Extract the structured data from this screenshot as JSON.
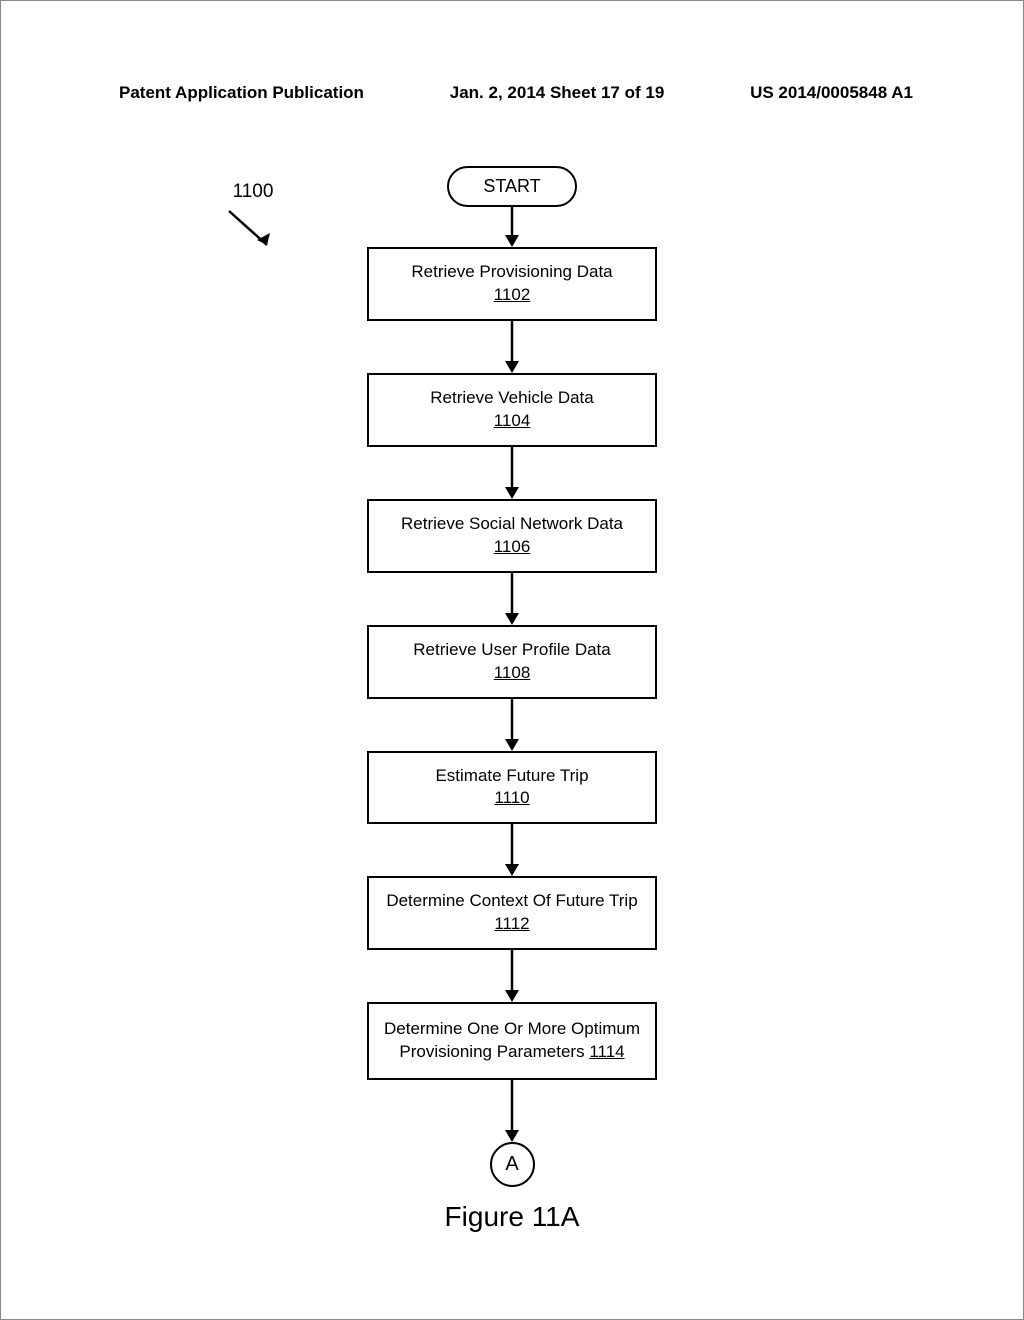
{
  "header": {
    "left": "Patent Application Publication",
    "center": "Jan. 2, 2014   Sheet 17 of 19",
    "right": "US 2014/0005848 A1"
  },
  "diagram": {
    "reference_number": "1100",
    "start_label": "START",
    "connector_label": "A",
    "caption": "Figure 11A",
    "steps": [
      {
        "text": "Retrieve Provisioning Data",
        "ref": "1102"
      },
      {
        "text": "Retrieve Vehicle Data",
        "ref": "1104"
      },
      {
        "text": "Retrieve Social Network Data",
        "ref": "1106"
      },
      {
        "text": "Retrieve User Profile Data",
        "ref": "1108"
      },
      {
        "text": "Estimate Future Trip",
        "ref": "1110"
      },
      {
        "text": "Determine Context Of Future Trip",
        "ref": "1112"
      },
      {
        "text_a": "Determine One Or More Optimum Provisioning Parameters",
        "ref": "1114",
        "inline": true
      }
    ]
  }
}
